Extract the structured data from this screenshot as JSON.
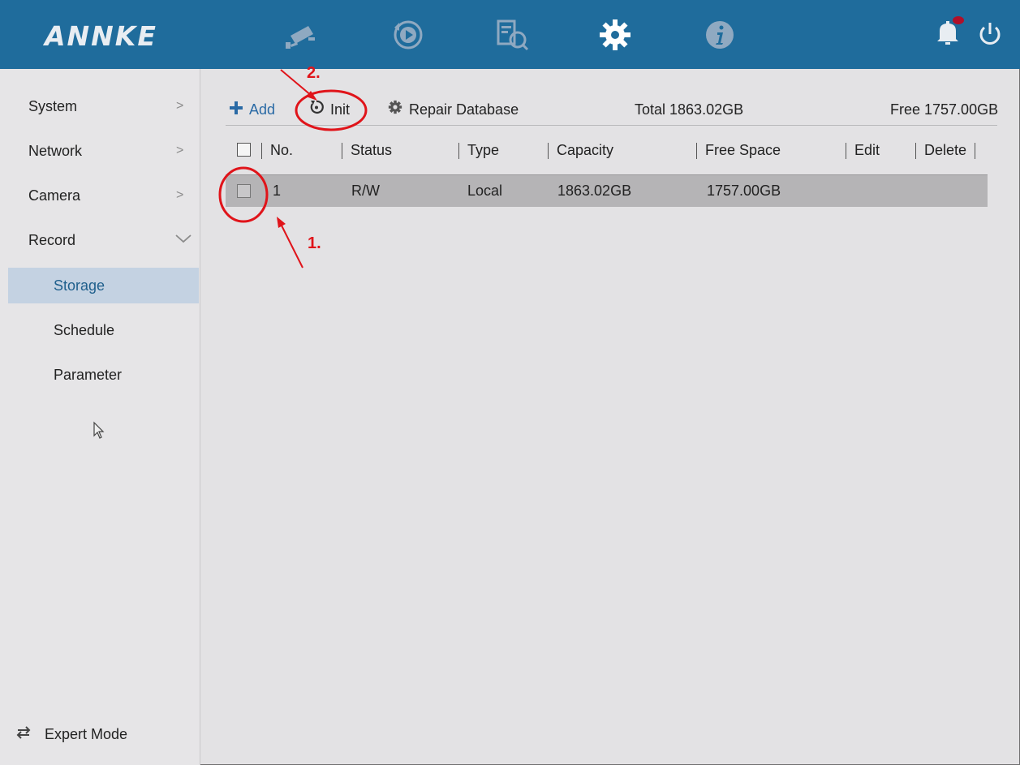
{
  "header": {
    "logo": "ANNKE",
    "icons": [
      "camera-icon",
      "playback-icon",
      "search-icon",
      "settings-icon",
      "info-icon",
      "notification-bell-icon",
      "power-icon"
    ],
    "colors": {
      "bar": "#1f6c9c",
      "notification": "#b0102a"
    }
  },
  "sidebar": {
    "items": [
      {
        "label": "System",
        "chevron": ">"
      },
      {
        "label": "Network",
        "chevron": ">"
      },
      {
        "label": "Camera",
        "chevron": ">"
      },
      {
        "label": "Record",
        "chevron": "v"
      }
    ],
    "subitems": [
      {
        "label": "Storage",
        "active": true
      },
      {
        "label": "Schedule",
        "active": false
      },
      {
        "label": "Parameter",
        "active": false
      }
    ],
    "expert_mode": "Expert Mode"
  },
  "toolbar": {
    "add": "Add",
    "init": "Init",
    "repair": "Repair Database",
    "total": "Total 1863.02GB",
    "free": "Free 1757.00GB"
  },
  "table": {
    "columns": [
      "No.",
      "Status",
      "Type",
      "Capacity",
      "Free Space",
      "Edit",
      "Delete"
    ],
    "rows": [
      {
        "no": "1",
        "status": "R/W",
        "type": "Local",
        "capacity": "1863.02GB",
        "free_space": "1757.00GB"
      }
    ]
  },
  "annotations": {
    "step1": "1.",
    "step2": "2.",
    "color": "#e0141a"
  }
}
